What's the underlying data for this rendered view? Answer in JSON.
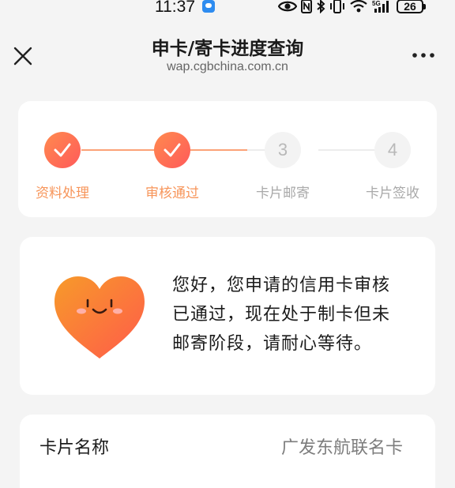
{
  "status_bar": {
    "time": "11:37",
    "battery": "26",
    "icons": [
      "message-icon",
      "eye-icon",
      "nfc-icon",
      "bluetooth-icon",
      "vibrate-icon",
      "wifi-icon",
      "signal-5g-icon",
      "battery-icon"
    ]
  },
  "header": {
    "title": "申卡/寄卡进度查询",
    "subtitle": "wap.cgbchina.com.cn",
    "close_icon": "close-icon",
    "more_icon": "more-icon"
  },
  "progress": {
    "accent_color": "#f7955a",
    "steps": [
      {
        "label": "资料处理",
        "state": "done",
        "number": ""
      },
      {
        "label": "审核通过",
        "state": "done",
        "number": ""
      },
      {
        "label": "卡片邮寄",
        "state": "todo",
        "number": "3"
      },
      {
        "label": "卡片签收",
        "state": "todo",
        "number": "4"
      }
    ]
  },
  "message": {
    "icon": "smiling-heart-icon",
    "line1": "您好，您申请的信用卡审核",
    "line2": "已通过，现在处于制卡但未",
    "line3": "邮寄阶段，请耐心等待。"
  },
  "card_info": {
    "label": "卡片名称",
    "value": "广发东航联名卡"
  }
}
